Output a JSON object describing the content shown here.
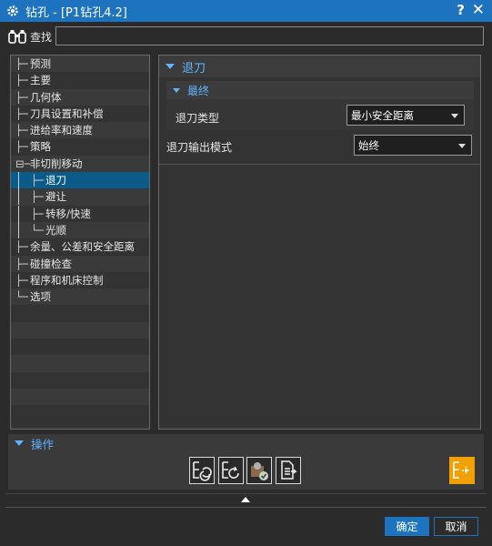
{
  "window": {
    "title": "钻孔 - [P1钻孔4.2]",
    "help_glyph": "?",
    "close_glyph": "✕"
  },
  "search": {
    "label": "查找",
    "value": ""
  },
  "tree": {
    "items": [
      {
        "label": "预测",
        "connector": "├─"
      },
      {
        "label": "主要",
        "connector": "├─"
      },
      {
        "label": "几何体",
        "connector": "├─"
      },
      {
        "label": "刀具设置和补偿",
        "connector": "├─"
      },
      {
        "label": "进给率和速度",
        "connector": "├─"
      },
      {
        "label": "策略",
        "connector": "├─"
      },
      {
        "label": "非切削移动",
        "connector": "⊟─"
      },
      {
        "label": "退刀",
        "connector": "├─"
      },
      {
        "label": "避让",
        "connector": "├─"
      },
      {
        "label": "转移/快速",
        "connector": "├─"
      },
      {
        "label": "光顺",
        "connector": "└─"
      },
      {
        "label": "余量、公差和安全距离",
        "connector": "├─"
      },
      {
        "label": "碰撞检查",
        "connector": "├─"
      },
      {
        "label": "程序和机床控制",
        "connector": "├─"
      },
      {
        "label": "选项",
        "connector": "└─"
      }
    ]
  },
  "main": {
    "section_title": "退刀",
    "subsection_title": "最终",
    "retract_type_label": "退刀类型",
    "retract_type_value": "最小安全距离",
    "output_mode_label": "退刀输出模式",
    "output_mode_value": "始终"
  },
  "operations": {
    "title": "操作"
  },
  "buttons": {
    "ok": "确定",
    "cancel": "取消"
  },
  "colors": {
    "accent": "#1e73be",
    "selected": "#0a5a8a",
    "section_text": "#5fb3ff",
    "active_tool": "#f0a000"
  }
}
